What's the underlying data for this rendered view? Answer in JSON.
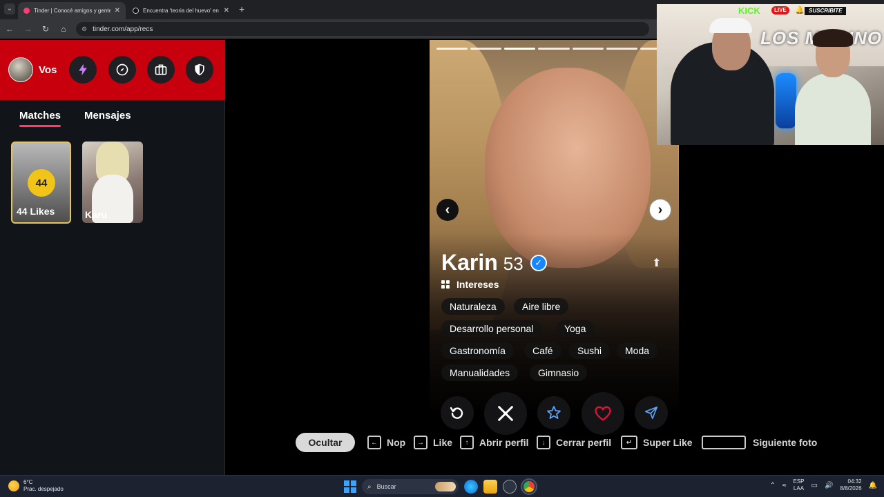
{
  "browser": {
    "tabs": [
      {
        "title": "Tinder | Conocé amigos y gente",
        "favicon_color": "#fe3c72"
      },
      {
        "title": "Encuentra 'teoria del huevo' en",
        "favicon_color": "#111111"
      }
    ],
    "url": "tinder.com/app/recs"
  },
  "sidebar": {
    "user_label": "Vos",
    "tabs": {
      "matches": "Matches",
      "messages": "Mensajes"
    },
    "likes_card": {
      "count": "44",
      "label": "44 Likes"
    },
    "match_card": {
      "name": "Karu"
    }
  },
  "profile": {
    "name": "Karin",
    "age": "53",
    "interests_label": "Intereses",
    "interests": [
      "Naturaleza",
      "Aire libre",
      "Desarrollo personal",
      "Yoga",
      "Gastronomía",
      "Café",
      "Sushi",
      "Moda",
      "Manualidades",
      "Gimnasio"
    ],
    "photo_count": 7,
    "current_photo": 3
  },
  "actions": [
    "rewind-icon",
    "nope-icon",
    "super-like-icon",
    "like-icon",
    "boost-icon"
  ],
  "hints": {
    "hide": "Ocultar",
    "nope": "Nop",
    "like": "Like",
    "open_profile": "Abrir perfil",
    "close_profile": "Cerrar perfil",
    "super_like": "Super Like",
    "next_photo": "Siguiente foto"
  },
  "webcam": {
    "kick": "KICK",
    "live": "LIVE",
    "subscribe": "SUSCRIBITE",
    "logo": "LOS MARINO"
  },
  "taskbar": {
    "temp": "6°C",
    "weather": "Prac. despejado",
    "search": "Buscar",
    "lang_top": "ESP",
    "lang_bottom": "LAA",
    "time": "04:32",
    "date": "8/8/2026"
  },
  "colors": {
    "brand": "#fe3c72",
    "header_red": "#c8000e",
    "like_red": "#e0123a",
    "verified_blue": "#1786ff",
    "likes_gold": "#f0c419"
  }
}
